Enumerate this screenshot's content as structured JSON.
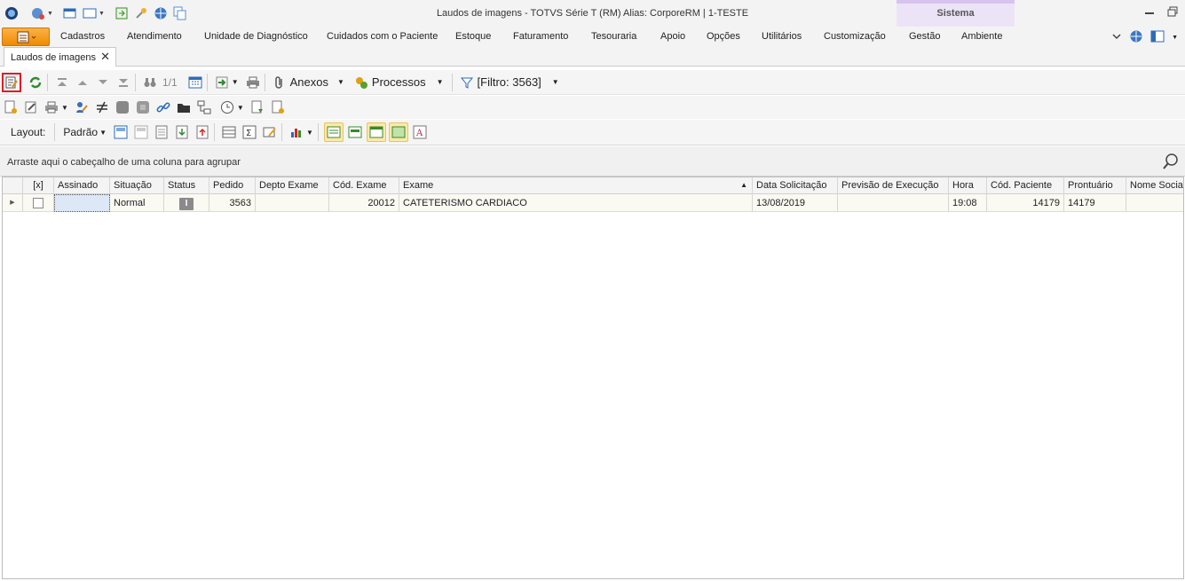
{
  "window": {
    "title": "Laudos de imagens - TOTVS Série T  (RM) Alias: CorporeRM | 1-TESTE",
    "context_tab": "Sistema"
  },
  "ribbon": {
    "tabs": [
      "Cadastros",
      "Atendimento",
      "Unidade de Diagnóstico",
      "Cuidados com o Paciente",
      "Estoque",
      "Faturamento",
      "Tesouraria",
      "Apoio",
      "Opções",
      "Utilitários",
      "Customização",
      "Gestão",
      "Ambiente"
    ]
  },
  "document_tab": {
    "label": "Laudos de imagens"
  },
  "toolbar": {
    "record_position": "1/1",
    "anexos_label": "Anexos",
    "processos_label": "Processos",
    "filter_label": "[Filtro: 3563]"
  },
  "layout_bar": {
    "layout_label": "Layout:",
    "padrao_label": "Padrão"
  },
  "group_panel": {
    "text": "Arraste aqui o cabeçalho de uma coluna para agrupar"
  },
  "grid": {
    "columns": [
      "[x]",
      "Assinado",
      "Situação",
      "Status",
      "Pedido",
      "Depto Exame",
      "Cód. Exame",
      "Exame",
      "Data Solicitação",
      "Previsão de Execução",
      "Hora",
      "Cód. Paciente",
      "Prontuário",
      "Nome Social"
    ],
    "rows": [
      {
        "checked": "",
        "assinado": "",
        "situacao": "Normal",
        "status": "I",
        "pedido": "3563",
        "depto_exame": "",
        "cod_exame": "20012",
        "exame": "CATETERISMO CARDIACO",
        "data_solicitacao": "13/08/2019",
        "previsao_execucao": "",
        "hora": "19:08",
        "cod_paciente": "14179",
        "prontuario": "14179",
        "nome_social": ""
      }
    ]
  },
  "colors": {
    "file_button": "#f39a1a",
    "context_tab": "#ece4f6",
    "selected_row": "#faf9f2",
    "highlight_button": "#fde9a8"
  }
}
